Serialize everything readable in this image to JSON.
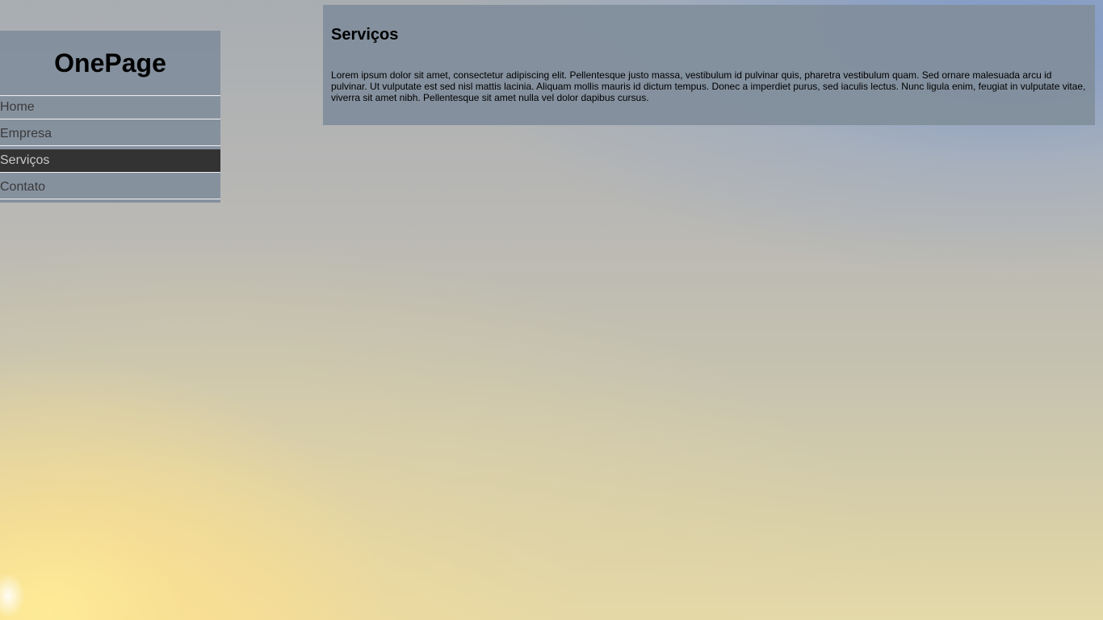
{
  "site": {
    "brand": "OnePage"
  },
  "nav": {
    "items": [
      {
        "label": "Home"
      },
      {
        "label": "Empresa"
      },
      {
        "label": "Serviços"
      },
      {
        "label": "Contato"
      }
    ],
    "active": "Serviços"
  },
  "section": {
    "title": "Serviços",
    "body": "Lorem ipsum dolor sit amet, consectetur adipiscing elit. Pellentesque justo massa, vestibulum id pulvinar quis, pharetra vestibulum quam. Sed ornare malesuada arcu id pulvinar. Ut vulputate est sed nisl mattis lacinia. Aliquam mollis mauris id dictum tempus. Donec a imperdiet purus, sed iaculis lectus. Nunc ligula enim, feugiat in vulputate vitae, viverra sit amet nibh. Pellentesque sit amet nulla vel dolor dapibus cursus."
  },
  "colors": {
    "panel": "#828e9c",
    "nav_active_bg": "#333333",
    "nav_text": "#3a3a3a",
    "nav_active_text": "#c8c8c8"
  }
}
